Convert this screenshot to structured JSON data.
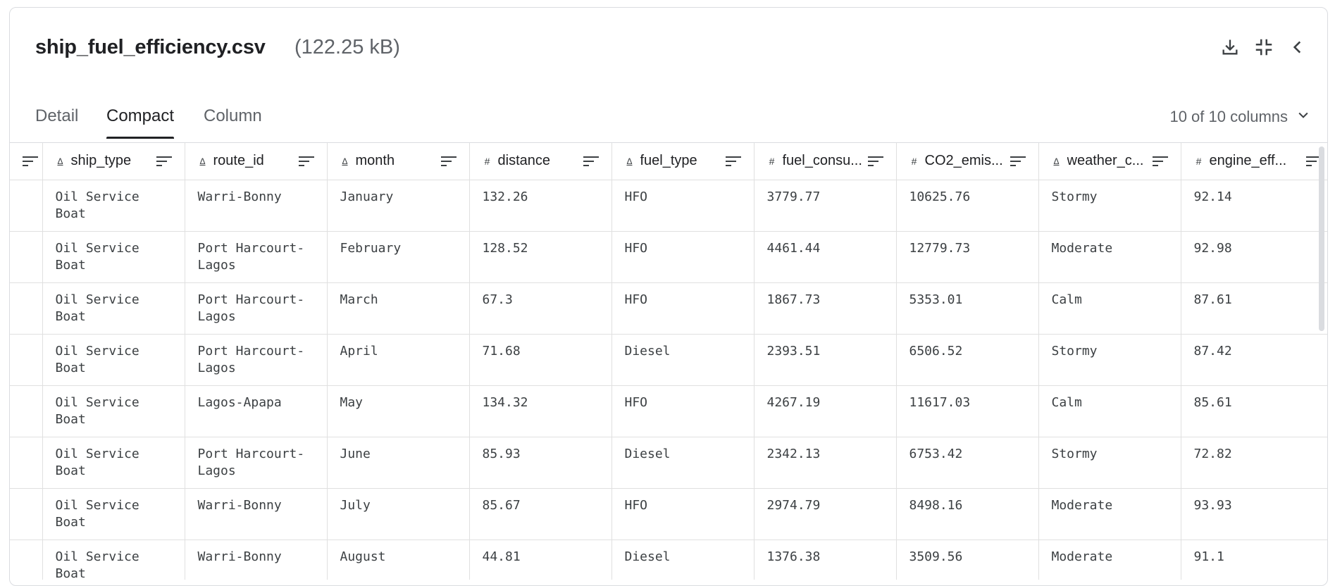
{
  "file": {
    "name": "ship_fuel_efficiency.csv",
    "size": "(122.25 kB)"
  },
  "header_icons": [
    "download-icon",
    "collapse-icon",
    "chevron-left-icon"
  ],
  "tabs": [
    {
      "label": "Detail",
      "active": false
    },
    {
      "label": "Compact",
      "active": true
    },
    {
      "label": "Column",
      "active": false
    }
  ],
  "column_count": "10 of 10 columns",
  "columns": [
    {
      "name": "ship_type",
      "type": "string"
    },
    {
      "name": "route_id",
      "type": "string"
    },
    {
      "name": "month",
      "type": "string"
    },
    {
      "name": "distance",
      "type": "numeric"
    },
    {
      "name": "fuel_type",
      "type": "string"
    },
    {
      "name": "fuel_consu...",
      "type": "numeric"
    },
    {
      "name": "CO2_emis...",
      "type": "numeric"
    },
    {
      "name": "weather_c...",
      "type": "string"
    },
    {
      "name": "engine_eff...",
      "type": "numeric"
    }
  ],
  "rows": [
    [
      "Oil Service Boat",
      "Warri-Bonny",
      "January",
      "132.26",
      "HFO",
      "3779.77",
      "10625.76",
      "Stormy",
      "92.14"
    ],
    [
      "Oil Service Boat",
      "Port Harcourt-Lagos",
      "February",
      "128.52",
      "HFO",
      "4461.44",
      "12779.73",
      "Moderate",
      "92.98"
    ],
    [
      "Oil Service Boat",
      "Port Harcourt-Lagos",
      "March",
      "67.3",
      "HFO",
      "1867.73",
      "5353.01",
      "Calm",
      "87.61"
    ],
    [
      "Oil Service Boat",
      "Port Harcourt-Lagos",
      "April",
      "71.68",
      "Diesel",
      "2393.51",
      "6506.52",
      "Stormy",
      "87.42"
    ],
    [
      "Oil Service Boat",
      "Lagos-Apapa",
      "May",
      "134.32",
      "HFO",
      "4267.19",
      "11617.03",
      "Calm",
      "85.61"
    ],
    [
      "Oil Service Boat",
      "Port Harcourt-Lagos",
      "June",
      "85.93",
      "Diesel",
      "2342.13",
      "6753.42",
      "Stormy",
      "72.82"
    ],
    [
      "Oil Service Boat",
      "Warri-Bonny",
      "July",
      "85.67",
      "HFO",
      "2974.79",
      "8498.16",
      "Moderate",
      "93.93"
    ],
    [
      "Oil Service Boat",
      "Warri-Bonny",
      "August",
      "44.81",
      "Diesel",
      "1376.38",
      "3509.56",
      "Moderate",
      "91.1"
    ]
  ]
}
